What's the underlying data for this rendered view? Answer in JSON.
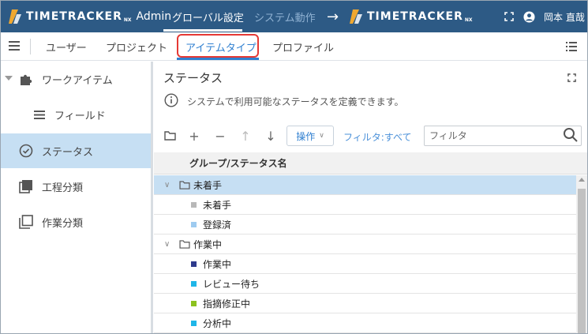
{
  "header": {
    "logo_text": "TIMETRACKER",
    "logo_suffix": "NX",
    "admin_label": "Admin",
    "nav": [
      {
        "label": "グローバル設定",
        "active": true
      },
      {
        "label": "システム動作",
        "active": false
      }
    ],
    "right_logo_text": "TIMETRACKER",
    "right_logo_suffix": "NX",
    "user_name": "岡本 直哉",
    "bg_color": "#2d5a85"
  },
  "tabs": [
    {
      "label": "ユーザー"
    },
    {
      "label": "プロジェクト"
    },
    {
      "label": "アイテムタイプ",
      "selected": true
    },
    {
      "label": "プロファイル"
    }
  ],
  "sidebar": {
    "items": [
      {
        "label": "ワークアイテム",
        "icon": "puzzle-icon"
      },
      {
        "label": "フィールド",
        "icon": "list-icon"
      },
      {
        "label": "ステータス",
        "icon": "check-circle-icon",
        "selected": true
      },
      {
        "label": "工程分類",
        "icon": "stack-filled-icon"
      },
      {
        "label": "作業分類",
        "icon": "stack-outline-icon"
      }
    ]
  },
  "main": {
    "title": "ステータス",
    "description": "システムで利用可能なステータスを定義できます。",
    "toolbar": {
      "ops_label": "操作",
      "filter_link": "フィルタ:すべて",
      "filter_placeholder": "フィルタ"
    },
    "column_header": "グループ/ステータス名",
    "groups": [
      {
        "name": "未着手",
        "selected": true,
        "statuses": [
          {
            "name": "未着手",
            "color": "#b8b8b8"
          },
          {
            "name": "登録済",
            "color": "#9ecbf0"
          }
        ]
      },
      {
        "name": "作業中",
        "selected": false,
        "statuses": [
          {
            "name": "作業中",
            "color": "#2e3a8c"
          },
          {
            "name": "レビュー待ち",
            "color": "#1fb6e8"
          },
          {
            "name": "指摘修正中",
            "color": "#8cc21f"
          },
          {
            "name": "分析中",
            "color": "#1fb6e8"
          }
        ]
      }
    ]
  }
}
